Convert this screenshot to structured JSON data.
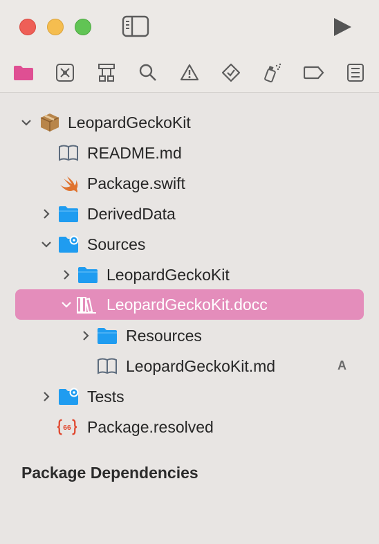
{
  "window": {
    "controls": [
      "close",
      "minimize",
      "zoom"
    ],
    "toolbar_icons": [
      "sidebar-toggle-icon",
      "run-icon"
    ]
  },
  "navigator_tabs": [
    {
      "name": "project-navigator",
      "icon": "folder-icon",
      "active": true
    },
    {
      "name": "source-control-navigator",
      "icon": "source-control-icon"
    },
    {
      "name": "symbol-navigator",
      "icon": "hierarchy-icon"
    },
    {
      "name": "find-navigator",
      "icon": "search-icon"
    },
    {
      "name": "issue-navigator",
      "icon": "warning-icon"
    },
    {
      "name": "test-navigator",
      "icon": "diamond-check-icon"
    },
    {
      "name": "debug-navigator",
      "icon": "spray-icon"
    },
    {
      "name": "breakpoint-navigator",
      "icon": "tag-icon"
    },
    {
      "name": "report-navigator",
      "icon": "list-icon"
    }
  ],
  "tree": {
    "root": {
      "label": "LeopardGeckoKit",
      "icon": "package-icon"
    },
    "readme": {
      "label": "README.md",
      "icon": "book-icon"
    },
    "package_swift": {
      "label": "Package.swift",
      "icon": "swift-icon"
    },
    "derived_data": {
      "label": "DerivedData",
      "icon": "folder-icon"
    },
    "sources": {
      "label": "Sources",
      "icon": "folder-gear-icon"
    },
    "sources_kit": {
      "label": "LeopardGeckoKit",
      "icon": "folder-icon"
    },
    "docc": {
      "label": "LeopardGeckoKit.docc",
      "icon": "docc-icon",
      "selected": true
    },
    "resources": {
      "label": "Resources",
      "icon": "folder-icon"
    },
    "kit_md": {
      "label": "LeopardGeckoKit.md",
      "icon": "book-icon",
      "badge": "A"
    },
    "tests": {
      "label": "Tests",
      "icon": "folder-gear-icon"
    },
    "resolved": {
      "label": "Package.resolved",
      "icon": "json-icon"
    }
  },
  "sections": {
    "package_dependencies": "Package Dependencies"
  },
  "colors": {
    "accent": "#e48dbb",
    "folder": "#1f9cf0",
    "swift": "#e0732e",
    "json": "#e0462d"
  }
}
